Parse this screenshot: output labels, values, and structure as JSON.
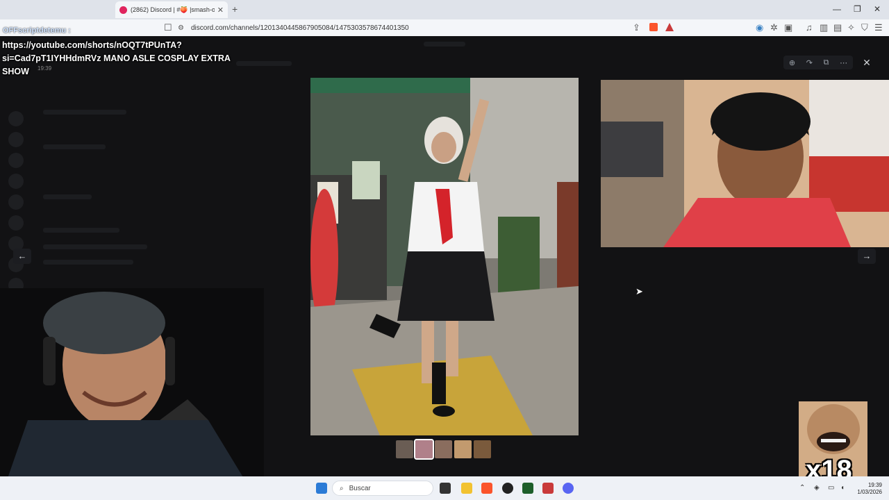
{
  "browser": {
    "tab_title": "(2862) Discord | #🍑 |smash-or-",
    "url": "discord.com/channels/1201340445867905084/1475303578674401350",
    "overlay_tag": "OFFscriptdetemu :"
  },
  "overlay": {
    "youtube_text": "https://youtube.com/shorts/nOQT7tPUnTA?si=Cad7pT1IYHHdmRVz MANO ASLE COSPLAY EXTRA SHOW",
    "timestamp": "19:39"
  },
  "viewer": {
    "thumbnail_count": 5
  },
  "emote": {
    "label": "x18"
  },
  "taskbar": {
    "search_placeholder": "Buscar",
    "time": "19:39",
    "date": "1/03/2026"
  },
  "colors": {
    "discord_bg": "#121214",
    "taskbar_bg": "#eef1f6",
    "accent_red": "#e0245e"
  }
}
